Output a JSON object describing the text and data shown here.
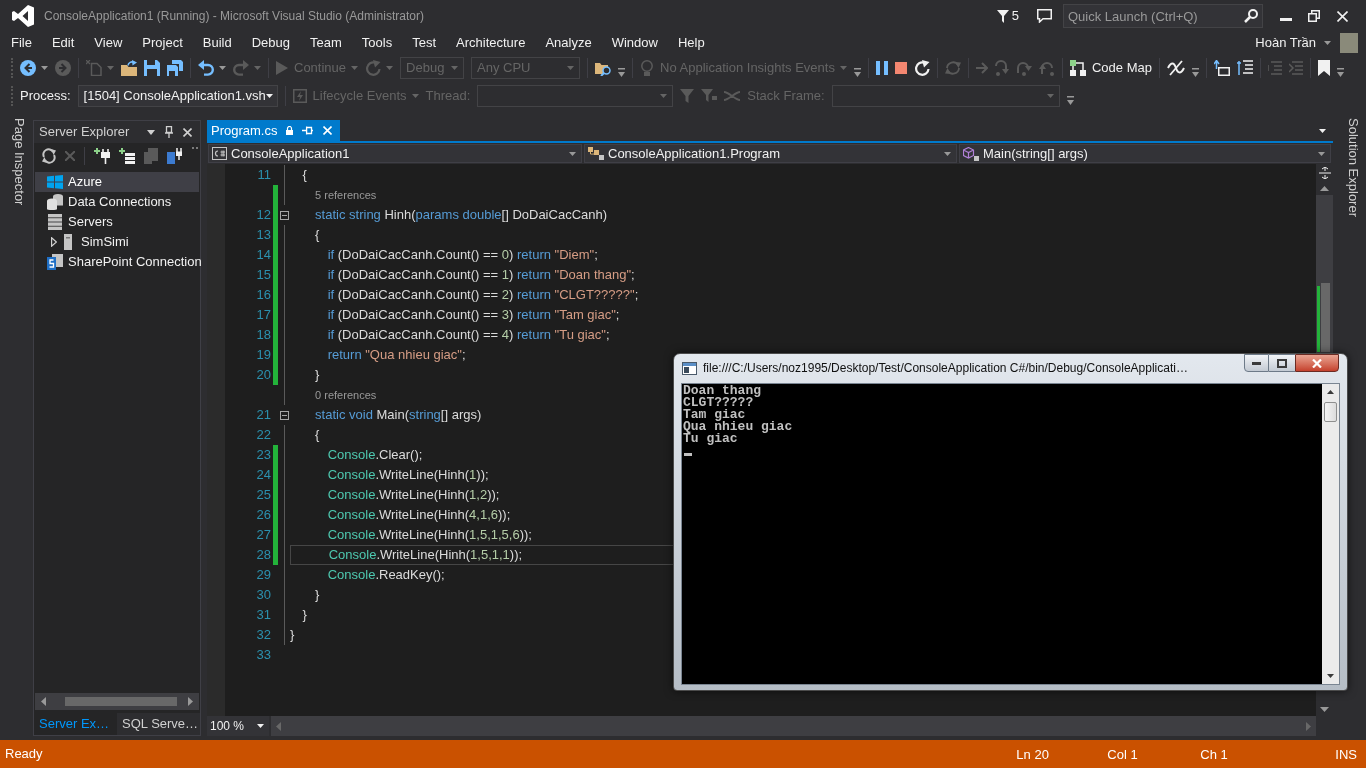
{
  "title_bar": {
    "title": "ConsoleApplication1 (Running) - Microsoft Visual Studio (Administrator)",
    "notifications": "5",
    "quick_launch": {
      "placeholder": "Quick Launch (Ctrl+Q)"
    }
  },
  "menu": [
    "File",
    "Edit",
    "View",
    "Project",
    "Build",
    "Debug",
    "Team",
    "Tools",
    "Test",
    "Architecture",
    "Analyze",
    "Window",
    "Help"
  ],
  "account": {
    "name": "Hoàn Trần"
  },
  "toolbar": {
    "groups": [
      {
        "items": [
          {
            "kind": "back",
            "disabled": false
          },
          {
            "kind": "forward",
            "disabled": true
          }
        ]
      },
      {
        "items": [
          {
            "kind": "new",
            "disabled": true
          },
          {
            "kind": "open",
            "disabled": false
          },
          {
            "kind": "save",
            "disabled": false
          },
          {
            "kind": "saveall",
            "disabled": false
          }
        ]
      },
      {
        "items": [
          {
            "kind": "undo",
            "disabled": false
          },
          {
            "kind": "redo",
            "disabled": true
          }
        ]
      },
      {
        "items": [
          {
            "kind": "continue",
            "label": "Continue",
            "disabled": true
          },
          {
            "kind": "restart",
            "disabled": true
          },
          {
            "kind": "combo",
            "value": "Debug",
            "disabled": true
          },
          {
            "kind": "combo",
            "value": "Any CPU",
            "disabled": true
          }
        ]
      },
      {
        "items": [
          {
            "kind": "find",
            "disabled": false
          },
          {
            "kind": "options",
            "disabled": false
          }
        ]
      },
      {
        "items": [
          {
            "kind": "insights",
            "label": "No Application Insights Events",
            "disabled": true
          },
          {
            "kind": "options",
            "disabled": false
          }
        ]
      },
      {
        "items": [
          {
            "kind": "pause",
            "disabled": false
          },
          {
            "kind": "stop",
            "disabled": false
          },
          {
            "kind": "reload",
            "disabled": false
          }
        ]
      },
      {
        "items": [
          {
            "kind": "apply",
            "disabled": true
          }
        ]
      },
      {
        "items": [
          {
            "kind": "next",
            "disabled": true
          },
          {
            "kind": "into",
            "disabled": true
          },
          {
            "kind": "over",
            "disabled": true
          },
          {
            "kind": "out",
            "disabled": true
          }
        ]
      },
      {
        "items": [
          {
            "kind": "codemap",
            "label": "Code Map",
            "disabled": false
          }
        ]
      },
      {
        "items": [
          {
            "kind": "unlink",
            "disabled": false
          },
          {
            "kind": "options",
            "disabled": false
          }
        ]
      },
      {
        "items": [
          {
            "kind": "outdent",
            "disabled": false
          },
          {
            "kind": "indent",
            "disabled": false
          }
        ]
      },
      {
        "items": [
          {
            "kind": "comment",
            "disabled": true
          },
          {
            "kind": "uncomment",
            "disabled": true
          }
        ]
      },
      {
        "items": [
          {
            "kind": "bookmark",
            "disabled": false
          },
          {
            "kind": "options",
            "disabled": false
          }
        ]
      }
    ]
  },
  "debug_location": {
    "groups": [
      {
        "items": [
          {
            "kind": "label",
            "text": "Process:",
            "disabled": false
          },
          {
            "kind": "combo",
            "value": "[1504] ConsoleApplication1.vsh",
            "disabled": false
          }
        ]
      },
      {
        "items": [
          {
            "kind": "lifecycle",
            "label": "Lifecycle Events",
            "disabled": true
          },
          {
            "kind": "label",
            "text": "Thread:",
            "disabled": true
          },
          {
            "kind": "combo",
            "disabled": true
          },
          {
            "kind": "filter",
            "disabled": true
          },
          {
            "kind": "flagfilter",
            "disabled": true
          },
          {
            "kind": "threads",
            "disabled": true
          },
          {
            "kind": "label",
            "text": "Stack Frame:",
            "disabled": true
          },
          {
            "kind": "combo",
            "disabled": true
          },
          {
            "kind": "options",
            "disabled": false
          }
        ]
      }
    ]
  },
  "left_tabs": [
    {
      "label": "Page Inspector"
    }
  ],
  "server_explorer": {
    "title": "Server Explorer",
    "toolbar": [
      {
        "kind": "refresh",
        "disabled": false
      },
      {
        "kind": "stop",
        "disabled": true
      },
      {
        "kind": "connect",
        "disabled": false
      },
      {
        "kind": "addserver",
        "disabled": false
      },
      {
        "kind": "sharepoint",
        "disabled": true
      },
      {
        "kind": "subscription",
        "disabled": false
      },
      {
        "kind": "options",
        "disabled": false
      }
    ],
    "tree": [
      {
        "kind": "azure",
        "label": "Azure",
        "selected": true
      },
      {
        "kind": "database",
        "label": "Data Connections",
        "selected": false
      },
      {
        "kind": "servers",
        "label": "Servers",
        "selected": false,
        "children": [
          {
            "kind": "server",
            "label": "SimSimi",
            "selected": false,
            "expanded": false
          }
        ]
      },
      {
        "kind": "sharepoint",
        "label": "SharePoint Connection",
        "selected": false
      }
    ],
    "tabs": [
      {
        "label": "Server Ex…",
        "selected": true
      },
      {
        "label": "SQL Serve…",
        "selected": false
      }
    ]
  },
  "editor": {
    "tabs": [
      {
        "label": "Program.cs",
        "selected": true
      }
    ],
    "navigation": [
      {
        "kind": "project",
        "text": "ConsoleApplication1"
      },
      {
        "kind": "class",
        "text": "ConsoleApplication1.Program"
      },
      {
        "kind": "method",
        "text": "Main(string[] args)"
      }
    ],
    "lines": [
      {
        "kind": "code",
        "number": "11",
        "modified": false,
        "current": false,
        "tokens": [
          {
            "text": "    {",
            "kind": "plain"
          }
        ]
      },
      {
        "kind": "lens",
        "text": "        5 references",
        "modified": true
      },
      {
        "kind": "fold",
        "number": "12",
        "expanded": true,
        "modified": true,
        "current": false,
        "tokens": [
          {
            "text": "        static string",
            "kind": "keyword"
          },
          {
            "text": " Hinh(",
            "kind": "plain"
          },
          {
            "text": "params double",
            "kind": "keyword"
          },
          {
            "text": "[] DoDaiCacCanh)",
            "kind": "plain"
          }
        ]
      },
      {
        "kind": "code",
        "number": "13",
        "modified": true,
        "current": false,
        "tokens": [
          {
            "text": "        {",
            "kind": "plain"
          }
        ]
      },
      {
        "kind": "code",
        "number": "14",
        "modified": true,
        "current": false,
        "tokens": [
          {
            "text": "            if",
            "kind": "keyword"
          },
          {
            "text": " (DoDaiCacCanh.Count() == ",
            "kind": "plain"
          },
          {
            "text": "0",
            "kind": "number"
          },
          {
            "text": ") ",
            "kind": "plain"
          },
          {
            "text": "return ",
            "kind": "keyword"
          },
          {
            "text": "\"Diem\"",
            "kind": "string"
          },
          {
            "text": ";",
            "kind": "plain"
          }
        ]
      },
      {
        "kind": "code",
        "number": "15",
        "modified": true,
        "current": false,
        "tokens": [
          {
            "text": "            if",
            "kind": "keyword"
          },
          {
            "text": " (DoDaiCacCanh.Count() == ",
            "kind": "plain"
          },
          {
            "text": "1",
            "kind": "number"
          },
          {
            "text": ") ",
            "kind": "plain"
          },
          {
            "text": "return ",
            "kind": "keyword"
          },
          {
            "text": "\"Doan thang\"",
            "kind": "string"
          },
          {
            "text": ";",
            "kind": "plain"
          }
        ]
      },
      {
        "kind": "code",
        "number": "16",
        "modified": true,
        "current": false,
        "tokens": [
          {
            "text": "            if",
            "kind": "keyword"
          },
          {
            "text": " (DoDaiCacCanh.Count() == ",
            "kind": "plain"
          },
          {
            "text": "2",
            "kind": "number"
          },
          {
            "text": ") ",
            "kind": "plain"
          },
          {
            "text": "return ",
            "kind": "keyword"
          },
          {
            "text": "\"CLGT?????\"",
            "kind": "string"
          },
          {
            "text": ";",
            "kind": "plain"
          }
        ]
      },
      {
        "kind": "code",
        "number": "17",
        "modified": true,
        "current": false,
        "tokens": [
          {
            "text": "            if",
            "kind": "keyword"
          },
          {
            "text": " (DoDaiCacCanh.Count() == ",
            "kind": "plain"
          },
          {
            "text": "3",
            "kind": "number"
          },
          {
            "text": ") ",
            "kind": "plain"
          },
          {
            "text": "return ",
            "kind": "keyword"
          },
          {
            "text": "\"Tam giac\"",
            "kind": "string"
          },
          {
            "text": ";",
            "kind": "plain"
          }
        ]
      },
      {
        "kind": "code",
        "number": "18",
        "modified": true,
        "current": false,
        "tokens": [
          {
            "text": "            if",
            "kind": "keyword"
          },
          {
            "text": " (DoDaiCacCanh.Count() == ",
            "kind": "plain"
          },
          {
            "text": "4",
            "kind": "number"
          },
          {
            "text": ") ",
            "kind": "plain"
          },
          {
            "text": "return ",
            "kind": "keyword"
          },
          {
            "text": "\"Tu giac\"",
            "kind": "string"
          },
          {
            "text": ";",
            "kind": "plain"
          }
        ]
      },
      {
        "kind": "code",
        "number": "19",
        "modified": true,
        "current": false,
        "tokens": [
          {
            "text": "            return ",
            "kind": "keyword"
          },
          {
            "text": "\"Qua nhieu giac\"",
            "kind": "string"
          },
          {
            "text": ";",
            "kind": "plain"
          }
        ]
      },
      {
        "kind": "code",
        "number": "20",
        "modified": true,
        "current": false,
        "tokens": [
          {
            "text": "        }",
            "kind": "plain"
          }
        ]
      },
      {
        "kind": "lens",
        "text": "        0 references",
        "modified": false
      },
      {
        "kind": "fold",
        "number": "21",
        "expanded": true,
        "modified": false,
        "current": false,
        "tokens": [
          {
            "text": "        static void",
            "kind": "keyword"
          },
          {
            "text": " Main(",
            "kind": "plain"
          },
          {
            "text": "string",
            "kind": "keyword"
          },
          {
            "text": "[] args)",
            "kind": "plain"
          }
        ]
      },
      {
        "kind": "code",
        "number": "22",
        "modified": false,
        "current": false,
        "tokens": [
          {
            "text": "        {",
            "kind": "plain"
          }
        ]
      },
      {
        "kind": "code",
        "number": "23",
        "modified": true,
        "current": false,
        "tokens": [
          {
            "text": "            Console",
            "kind": "type"
          },
          {
            "text": ".Clear();",
            "kind": "plain"
          }
        ]
      },
      {
        "kind": "code",
        "number": "24",
        "modified": true,
        "current": false,
        "tokens": [
          {
            "text": "            Console",
            "kind": "type"
          },
          {
            "text": ".WriteLine(Hinh(",
            "kind": "plain"
          },
          {
            "text": "1",
            "kind": "number"
          },
          {
            "text": "));",
            "kind": "plain"
          }
        ]
      },
      {
        "kind": "code",
        "number": "25",
        "modified": true,
        "current": false,
        "tokens": [
          {
            "text": "            Console",
            "kind": "type"
          },
          {
            "text": ".WriteLine(Hinh(",
            "kind": "plain"
          },
          {
            "text": "1,2",
            "kind": "number"
          },
          {
            "text": "));",
            "kind": "plain"
          }
        ]
      },
      {
        "kind": "code",
        "number": "26",
        "modified": true,
        "current": false,
        "tokens": [
          {
            "text": "            Console",
            "kind": "type"
          },
          {
            "text": ".WriteLine(Hinh(",
            "kind": "plain"
          },
          {
            "text": "4,1,6",
            "kind": "number"
          },
          {
            "text": "));",
            "kind": "plain"
          }
        ]
      },
      {
        "kind": "code",
        "number": "27",
        "modified": true,
        "current": false,
        "tokens": [
          {
            "text": "            Console",
            "kind": "type"
          },
          {
            "text": ".WriteLine(Hinh(",
            "kind": "plain"
          },
          {
            "text": "1,5,1,5,6",
            "kind": "number"
          },
          {
            "text": "));",
            "kind": "plain"
          }
        ]
      },
      {
        "kind": "code",
        "number": "28",
        "modified": true,
        "current": true,
        "tokens": [
          {
            "text": "            Console",
            "kind": "type"
          },
          {
            "text": ".WriteLine(Hinh(",
            "kind": "plain"
          },
          {
            "text": "1,5,1,1",
            "kind": "number"
          },
          {
            "text": "));",
            "kind": "plain"
          }
        ]
      },
      {
        "kind": "code",
        "number": "29",
        "modified": false,
        "current": false,
        "tokens": [
          {
            "text": "            Console",
            "kind": "type"
          },
          {
            "text": ".ReadKey();",
            "kind": "plain"
          }
        ]
      },
      {
        "kind": "code",
        "number": "30",
        "modified": false,
        "current": false,
        "tokens": [
          {
            "text": "        }",
            "kind": "plain"
          }
        ]
      },
      {
        "kind": "code",
        "number": "31",
        "modified": false,
        "current": false,
        "tokens": [
          {
            "text": "    }",
            "kind": "plain"
          }
        ]
      },
      {
        "kind": "code",
        "number": "32",
        "modified": false,
        "current": false,
        "tokens": [
          {
            "text": "}",
            "kind": "plain"
          }
        ]
      },
      {
        "kind": "code",
        "number": "33",
        "modified": false,
        "current": false
      }
    ],
    "zoom": "100 %"
  },
  "right_tabs": [
    {
      "label": "Solution Explorer"
    }
  ],
  "console": {
    "title": "file:///C:/Users/noz1995/Desktop/Test/ConsoleApplication C#/bin/Debug/ConsoleApplicati…",
    "lines": [
      "Doan thang",
      "CLGT?????",
      "Tam giac",
      "Qua nhieu giac",
      "Tu giac"
    ]
  },
  "status_bar": {
    "message": "Ready",
    "line": "Ln 20",
    "column": "Col 1",
    "character": "Ch 1",
    "mode": "INS"
  }
}
